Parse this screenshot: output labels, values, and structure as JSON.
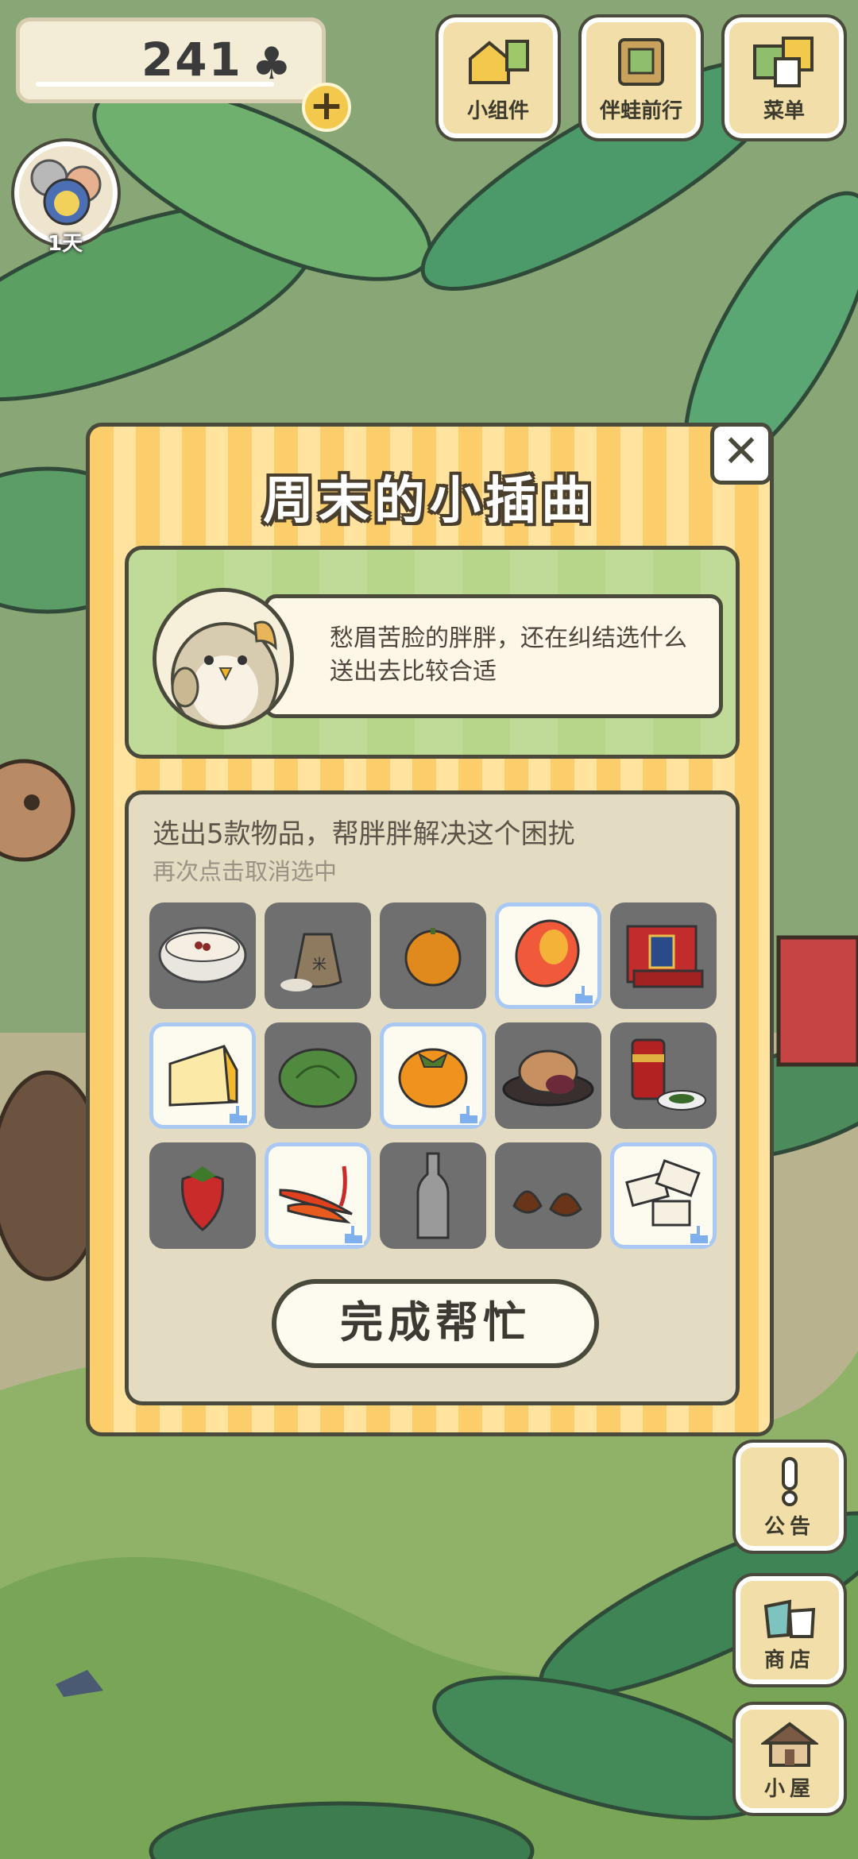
{
  "hud": {
    "clover_count": "241",
    "clover_symbol": "♣",
    "add_symbol": "+",
    "top_buttons": [
      {
        "label": "小组件",
        "icon": "widget-icon"
      },
      {
        "label": "伴蛙前行",
        "icon": "book-icon"
      },
      {
        "label": "菜单",
        "icon": "menu-cards-icon"
      }
    ],
    "visitor_day": "1天"
  },
  "dialog": {
    "title": "周末的小插曲",
    "close_symbol": "✕",
    "speech": "愁眉苦脸的胖胖，还在纠结选什么送出去比较合适",
    "instruction": "选出5款物品，帮胖胖解决这个困扰",
    "hint": "再次点击取消选中",
    "items": [
      {
        "icon": "porridge-bowl-icon",
        "selected": false
      },
      {
        "icon": "rice-sack-icon",
        "selected": false
      },
      {
        "icon": "orange-icon",
        "selected": false
      },
      {
        "icon": "mango-icon",
        "selected": true
      },
      {
        "icon": "gift-box-icon",
        "selected": false
      },
      {
        "icon": "cheese-icon",
        "selected": true
      },
      {
        "icon": "cabbage-icon",
        "selected": false
      },
      {
        "icon": "persimmon-icon",
        "selected": true
      },
      {
        "icon": "mooncake-icon",
        "selected": false
      },
      {
        "icon": "tea-can-icon",
        "selected": false
      },
      {
        "icon": "strawberry-icon",
        "selected": false
      },
      {
        "icon": "chili-pepper-icon",
        "selected": true
      },
      {
        "icon": "bottle-icon",
        "selected": false
      },
      {
        "icon": "chestnut-icon",
        "selected": false
      },
      {
        "icon": "nougat-icon",
        "selected": true
      }
    ],
    "confirm_label": "完成帮忙"
  },
  "side_buttons": [
    {
      "label": "公告",
      "icon": "exclamation-icon"
    },
    {
      "label": "商店",
      "icon": "shop-bags-icon"
    },
    {
      "label": "小屋",
      "icon": "house-icon"
    }
  ],
  "colors": {
    "dialog_stripe_a": "#fbcd6b",
    "dialog_stripe_b": "#ffe39f",
    "outline": "#4a4a3c",
    "selected_border": "#a9c8f3"
  }
}
